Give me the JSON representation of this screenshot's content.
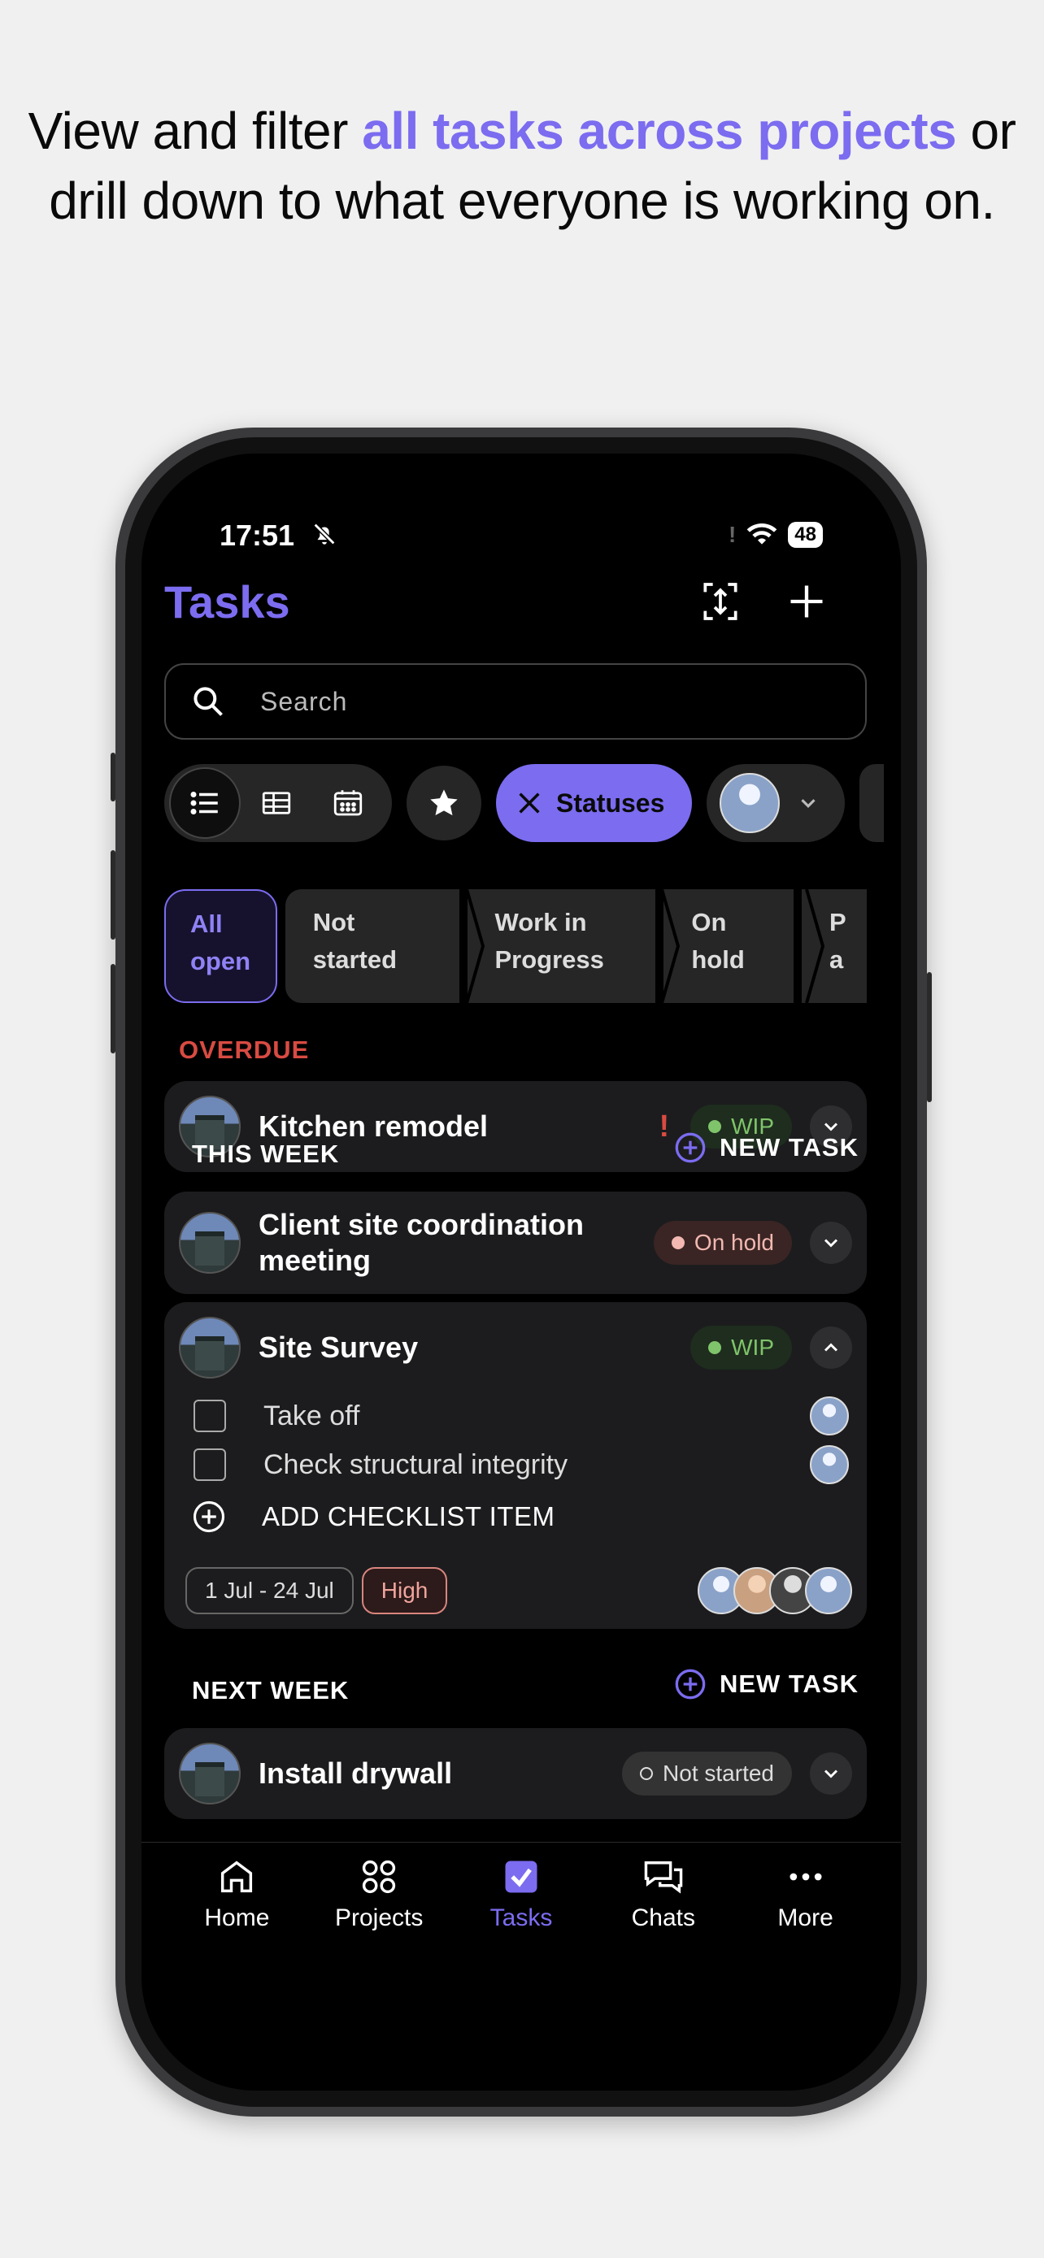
{
  "headline": {
    "part1": "View and filter ",
    "accent": "all tasks across projects",
    "part2": " or drill down to what everyone is working on."
  },
  "status_bar": {
    "time": "17:51",
    "battery": "48"
  },
  "header": {
    "title": "Tasks"
  },
  "search": {
    "placeholder": "Search"
  },
  "filters": {
    "statuses_label": "Statuses"
  },
  "status_tabs": [
    {
      "line1": "All",
      "line2": "open"
    },
    {
      "line1": "Not",
      "line2": "started"
    },
    {
      "line1": "Work in",
      "line2": "Progress"
    },
    {
      "line1": "On",
      "line2": "hold"
    },
    {
      "line1": "P",
      "line2": "a"
    }
  ],
  "sections": {
    "overdue": "OVERDUE",
    "this_week": "THIS WEEK",
    "next_week": "NEXT WEEK",
    "new_task": "NEW TASK"
  },
  "tasks": {
    "kitchen": {
      "title": "Kitchen remodel",
      "status": "WIP",
      "flag": "!"
    },
    "client": {
      "title_line1": "Client site coordination",
      "title_line2": "meeting",
      "status": "On hold"
    },
    "survey": {
      "title": "Site Survey",
      "status": "WIP",
      "checklist": [
        "Take off",
        "Check structural integrity"
      ],
      "add_item": "ADD CHECKLIST ITEM",
      "dates": "1 Jul - 24 Jul",
      "priority": "High"
    },
    "drywall": {
      "title": "Install drywall",
      "status": "Not started"
    }
  },
  "nav": {
    "home": "Home",
    "projects": "Projects",
    "tasks": "Tasks",
    "chats": "Chats",
    "more": "More"
  },
  "colors": {
    "accent": "#7b6cf0",
    "overdue": "#d84b42",
    "wip": "#7fc46a",
    "hold": "#f2b8b1"
  }
}
